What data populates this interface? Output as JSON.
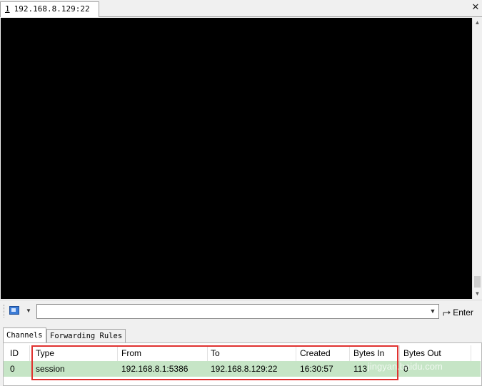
{
  "session_tab": {
    "number": "1",
    "title": "192.168.8.129:22",
    "close_glyph": "✕"
  },
  "command_bar": {
    "input_value": "",
    "enter_label": "Enter",
    "send_icon": "terminal-send-icon"
  },
  "bottom_tabs": [
    {
      "label": "Channels",
      "active": true
    },
    {
      "label": "Forwarding Rules",
      "active": false
    }
  ],
  "channels": {
    "columns": [
      "ID",
      "Type",
      "From",
      "To",
      "Created",
      "Bytes In",
      "Bytes Out"
    ],
    "rows": [
      {
        "id": "0",
        "type": "session",
        "from": "192.168.8.1:5386",
        "to": "192.168.8.129:22",
        "created": "16:30:57",
        "bytes_in": "113",
        "bytes_out": "0"
      }
    ],
    "selected_row_color": "#c6e5c6"
  },
  "annotation": {
    "color": "#e0312f"
  },
  "watermark": "jingyan.baidu.com"
}
